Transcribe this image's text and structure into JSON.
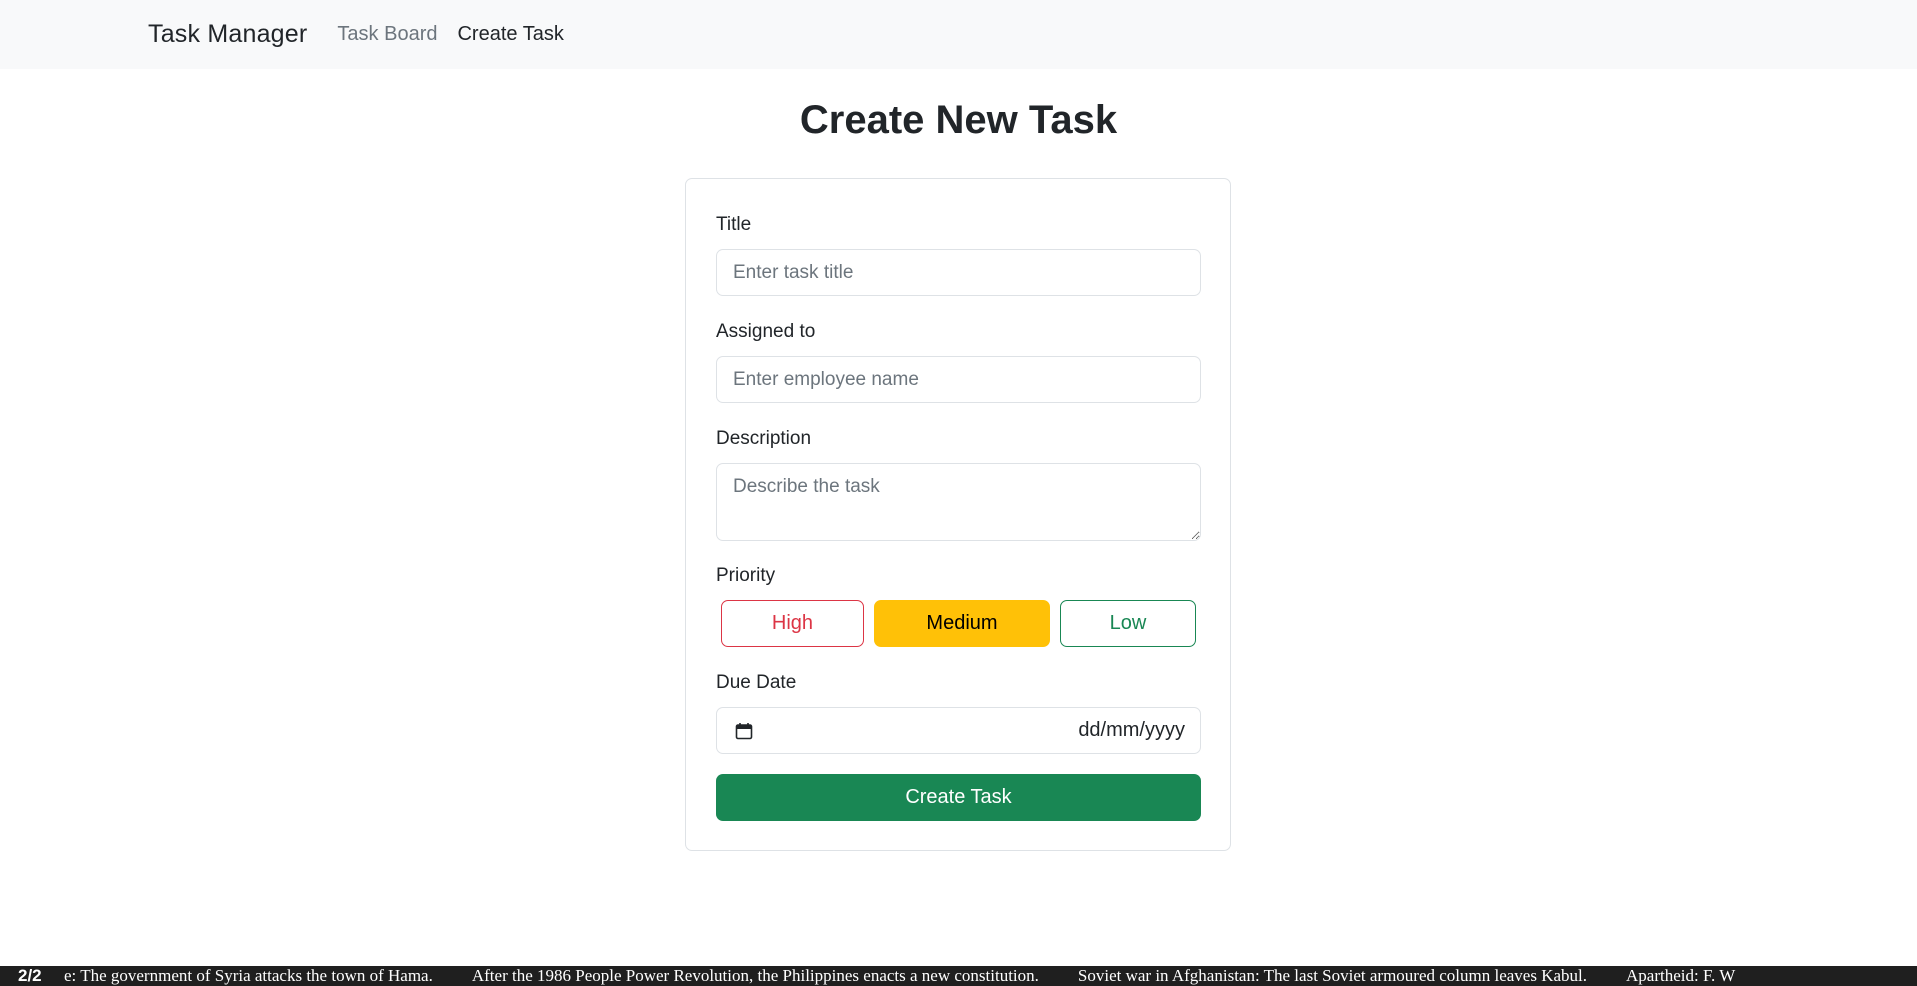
{
  "navbar": {
    "brand": "Task Manager",
    "links": [
      {
        "label": "Task Board",
        "active": false
      },
      {
        "label": "Create Task",
        "active": true
      }
    ]
  },
  "page": {
    "title": "Create New Task"
  },
  "form": {
    "title_label": "Title",
    "title_placeholder": "Enter task title",
    "title_value": "",
    "assigned_label": "Assigned to",
    "assigned_placeholder": "Enter employee name",
    "assigned_value": "",
    "description_label": "Description",
    "description_placeholder": "Describe the task",
    "description_value": "",
    "priority_label": "Priority",
    "priority_options": [
      {
        "label": "High",
        "selected": false,
        "color": "#dc3545"
      },
      {
        "label": "Medium",
        "selected": true,
        "color": "#ffc107"
      },
      {
        "label": "Low",
        "selected": false,
        "color": "#198754"
      }
    ],
    "due_date_label": "Due Date",
    "due_date_placeholder": "dd/mm/yyyy",
    "submit_label": "Create Task"
  },
  "ticker": {
    "count": "2/2",
    "items": [
      "e: The government of Syria attacks the town of Hama.",
      "After the 1986 People Power Revolution, the Philippines enacts a new constitution.",
      "Soviet war in Afghanistan: The last Soviet armoured column leaves Kabul.",
      "Apartheid: F. W"
    ]
  },
  "colors": {
    "navbar_bg": "#f8f9fa",
    "primary_green": "#198754",
    "warning_yellow": "#ffc107",
    "danger_red": "#dc3545"
  }
}
